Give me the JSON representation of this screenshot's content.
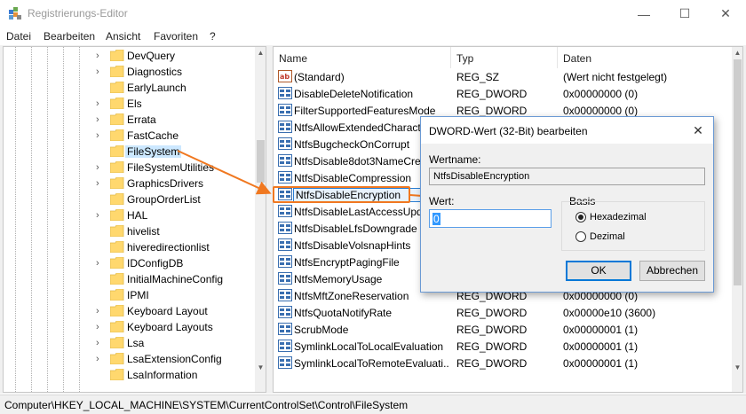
{
  "window": {
    "title": "Registrierungs-Editor",
    "minimize_glyph": "—",
    "maximize_glyph": "☐",
    "close_glyph": "✕"
  },
  "menu": [
    "Datei",
    "Bearbeiten",
    "Ansicht",
    "Favoriten",
    "?"
  ],
  "tree": {
    "items": [
      {
        "label": "DevQuery",
        "expandable": true
      },
      {
        "label": "Diagnostics",
        "expandable": true
      },
      {
        "label": "EarlyLaunch",
        "expandable": false
      },
      {
        "label": "Els",
        "expandable": true
      },
      {
        "label": "Errata",
        "expandable": true
      },
      {
        "label": "FastCache",
        "expandable": true
      },
      {
        "label": "FileSystem",
        "expandable": false,
        "selected": true
      },
      {
        "label": "FileSystemUtilities",
        "expandable": true
      },
      {
        "label": "GraphicsDrivers",
        "expandable": true
      },
      {
        "label": "GroupOrderList",
        "expandable": false
      },
      {
        "label": "HAL",
        "expandable": true
      },
      {
        "label": "hivelist",
        "expandable": false
      },
      {
        "label": "hiveredirectionlist",
        "expandable": false
      },
      {
        "label": "IDConfigDB",
        "expandable": true
      },
      {
        "label": "InitialMachineConfig",
        "expandable": false
      },
      {
        "label": "IPMI",
        "expandable": false
      },
      {
        "label": "Keyboard Layout",
        "expandable": true
      },
      {
        "label": "Keyboard Layouts",
        "expandable": true
      },
      {
        "label": "Lsa",
        "expandable": true
      },
      {
        "label": "LsaExtensionConfig",
        "expandable": true
      },
      {
        "label": "LsaInformation",
        "expandable": false
      }
    ]
  },
  "list": {
    "headers": {
      "name": "Name",
      "type": "Typ",
      "data": "Daten"
    },
    "rows": [
      {
        "icon": "string",
        "name": "(Standard)",
        "type": "REG_SZ",
        "data": "(Wert nicht festgelegt)"
      },
      {
        "icon": "dword",
        "name": "DisableDeleteNotification",
        "type": "REG_DWORD",
        "data": "0x00000000 (0)"
      },
      {
        "icon": "dword",
        "name": "FilterSupportedFeaturesMode",
        "type": "REG_DWORD",
        "data": "0x00000000 (0)"
      },
      {
        "icon": "dword",
        "name": "NtfsAllowExtendedCharacte",
        "type": "",
        "data": ""
      },
      {
        "icon": "dword",
        "name": "NtfsBugcheckOnCorrupt",
        "type": "",
        "data": ""
      },
      {
        "icon": "dword",
        "name": "NtfsDisable8dot3NameCrea",
        "type": "",
        "data": ""
      },
      {
        "icon": "dword",
        "name": "NtfsDisableCompression",
        "type": "",
        "data": ""
      },
      {
        "icon": "dword",
        "name": "NtfsDisableEncryption",
        "type": "",
        "data": "",
        "highlight": true
      },
      {
        "icon": "dword",
        "name": "NtfsDisableLastAccessUpda",
        "type": "",
        "data": ""
      },
      {
        "icon": "dword",
        "name": "NtfsDisableLfsDowngrade",
        "type": "",
        "data": ""
      },
      {
        "icon": "dword",
        "name": "NtfsDisableVolsnapHints",
        "type": "",
        "data": ""
      },
      {
        "icon": "dword",
        "name": "NtfsEncryptPagingFile",
        "type": "",
        "data": ""
      },
      {
        "icon": "dword",
        "name": "NtfsMemoryUsage",
        "type": "",
        "data": ""
      },
      {
        "icon": "dword",
        "name": "NtfsMftZoneReservation",
        "type": "REG_DWORD",
        "data": "0x00000000 (0)"
      },
      {
        "icon": "dword",
        "name": "NtfsQuotaNotifyRate",
        "type": "REG_DWORD",
        "data": "0x00000e10 (3600)"
      },
      {
        "icon": "dword",
        "name": "ScrubMode",
        "type": "REG_DWORD",
        "data": "0x00000001 (1)"
      },
      {
        "icon": "dword",
        "name": "SymlinkLocalToLocalEvaluation",
        "type": "REG_DWORD",
        "data": "0x00000001 (1)"
      },
      {
        "icon": "dword",
        "name": "SymlinkLocalToRemoteEvaluati...",
        "type": "REG_DWORD",
        "data": "0x00000001 (1)"
      }
    ]
  },
  "status": {
    "path": "Computer\\HKEY_LOCAL_MACHINE\\SYSTEM\\CurrentControlSet\\Control\\FileSystem"
  },
  "dialog": {
    "title": "DWORD-Wert (32-Bit) bearbeiten",
    "close_glyph": "✕",
    "value_name_label": "Wertname:",
    "value_name": "NtfsDisableEncryption",
    "value_label": "Wert:",
    "value": "0",
    "basis_label": "Basis",
    "hex_label": "Hexadezimal",
    "dec_label": "Dezimal",
    "hex_checked": true,
    "ok_label": "OK",
    "cancel_label": "Abbrechen"
  },
  "colors": {
    "annotation": "#f07820",
    "selection": "#cce8ff",
    "accent": "#0078d7"
  }
}
